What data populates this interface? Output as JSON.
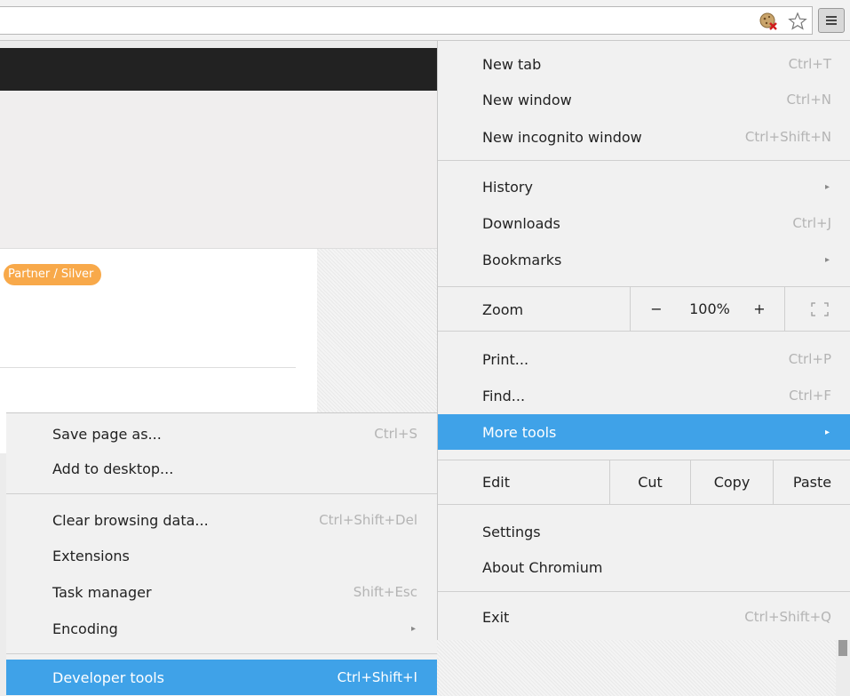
{
  "page": {
    "badge": "Partner / Silver"
  },
  "main_menu": {
    "items": [
      {
        "label": "New tab",
        "shortcut": "Ctrl+T"
      },
      {
        "label": "New window",
        "shortcut": "Ctrl+N"
      },
      {
        "label": "New incognito window",
        "shortcut": "Ctrl+Shift+N"
      },
      {
        "label": "History",
        "submenu": true
      },
      {
        "label": "Downloads",
        "shortcut": "Ctrl+J"
      },
      {
        "label": "Bookmarks",
        "submenu": true
      },
      {
        "label": "Print...",
        "shortcut": "Ctrl+P"
      },
      {
        "label": "Find...",
        "shortcut": "Ctrl+F"
      },
      {
        "label": "More tools",
        "submenu": true,
        "highlighted": true
      },
      {
        "label": "Settings"
      },
      {
        "label": "About Chromium"
      },
      {
        "label": "Exit",
        "shortcut": "Ctrl+Shift+Q"
      }
    ],
    "zoom": {
      "label": "Zoom",
      "minus": "−",
      "value": "100%",
      "plus": "+"
    },
    "edit": {
      "label": "Edit",
      "cut": "Cut",
      "copy": "Copy",
      "paste": "Paste"
    }
  },
  "sub_menu": {
    "items": [
      {
        "label": "Save page as...",
        "shortcut": "Ctrl+S"
      },
      {
        "label": "Add to desktop..."
      },
      {
        "label": "Clear browsing data...",
        "shortcut": "Ctrl+Shift+Del"
      },
      {
        "label": "Extensions"
      },
      {
        "label": "Task manager",
        "shortcut": "Shift+Esc"
      },
      {
        "label": "Encoding",
        "submenu": true
      },
      {
        "label": "Developer tools",
        "shortcut": "Ctrl+Shift+I",
        "highlighted": true
      }
    ]
  },
  "icons": {
    "cookie_blocked": "cookie-blocked-icon",
    "bookmark_star": "star-icon",
    "menu": "hamburger-menu-icon",
    "submenu_arrow": "▸",
    "fullscreen": "fullscreen-icon"
  },
  "colors": {
    "highlight": "#3fa2e8",
    "badge": "#f8a94a"
  }
}
